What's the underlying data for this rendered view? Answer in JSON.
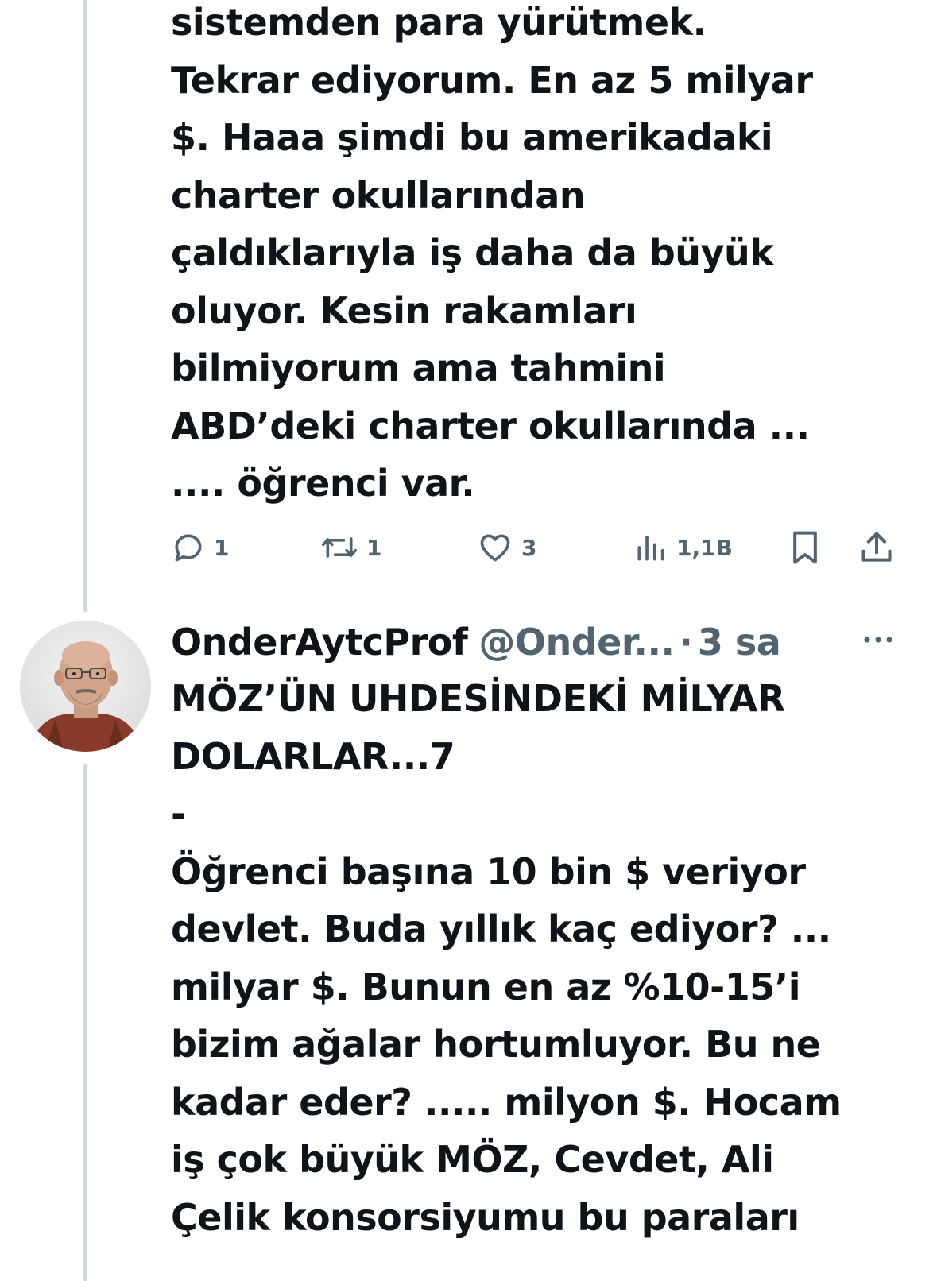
{
  "tweet1": {
    "text_lines": [
      "sistemden para yürütmek.",
      "Tekrar ediyorum. En az 5 milyar",
      "$.  Haaa şimdi bu amerikadaki",
      "charter okullarından",
      "çaldıklarıyla iş daha da büyük",
      "oluyor. Kesin rakamları",
      "bilmiyorum ama tahmini",
      "ABD’deki charter okullarında ...",
      ".... öğrenci var."
    ],
    "actions": {
      "reply_count": "1",
      "retweet_count": "1",
      "like_count": "3",
      "views_count": "1,1B"
    }
  },
  "tweet2": {
    "author_name": "OnderAytcProf",
    "author_handle": "@Onder...",
    "separator": "·",
    "time": "3 sa",
    "more_label": "···",
    "text_lines": [
      "MÖZ’ÜN UHDESİNDEKİ MİLYAR",
      "DOLARLAR...7",
      "-",
      "Öğrenci başına 10 bin $ veriyor",
      "devlet. Buda yıllık kaç ediyor? ...",
      "milyar $. Bunun en az %10-15’i",
      "bizim ağalar hortumluyor. Bu ne",
      "kadar eder? ..... milyon $. Hocam",
      "iş çok büyük  MÖZ, Cevdet, Ali",
      "Çelik konsorsiyumu bu paraları"
    ]
  },
  "icons": {
    "reply": "reply-icon",
    "retweet": "retweet-icon",
    "like": "heart-icon",
    "views": "views-icon",
    "bookmark": "bookmark-icon",
    "share": "share-icon",
    "more": "more-icon"
  },
  "colors": {
    "text": "#0f1419",
    "secondary": "#536471",
    "thread_line": "#cfd9de"
  }
}
